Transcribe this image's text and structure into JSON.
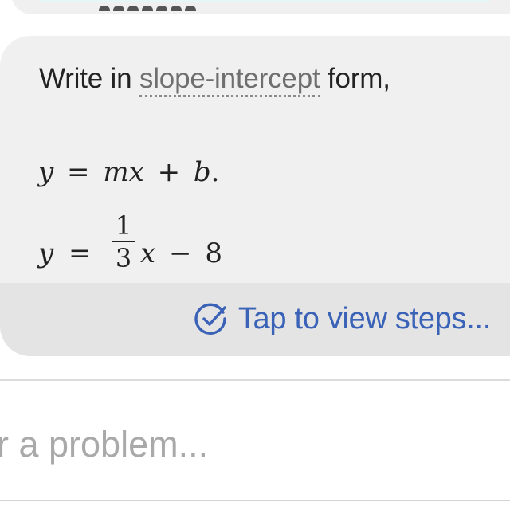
{
  "answer": {
    "intro_prefix": "Write in ",
    "intro_term": "slope-intercept",
    "intro_suffix": " form,",
    "general_form": {
      "y": "y",
      "equals": "=",
      "m": "m",
      "x": "x",
      "plus": "+",
      "b": "b",
      "period": "."
    },
    "result": {
      "y": "y",
      "equals": "=",
      "numerator": "1",
      "denominator": "3",
      "x": "x",
      "minus": "−",
      "constant": "8"
    },
    "steps_link": {
      "label": "Tap to view steps...",
      "icon": "check-circle-icon"
    }
  },
  "input": {
    "placeholder": "r a problem...",
    "value": ""
  },
  "colors": {
    "card_background": "#f0f0f0",
    "steps_bar_background": "#e4e4e4",
    "link_blue": "#3a62b6",
    "term_gray": "#6f6f6f",
    "text_dark": "#222222"
  }
}
